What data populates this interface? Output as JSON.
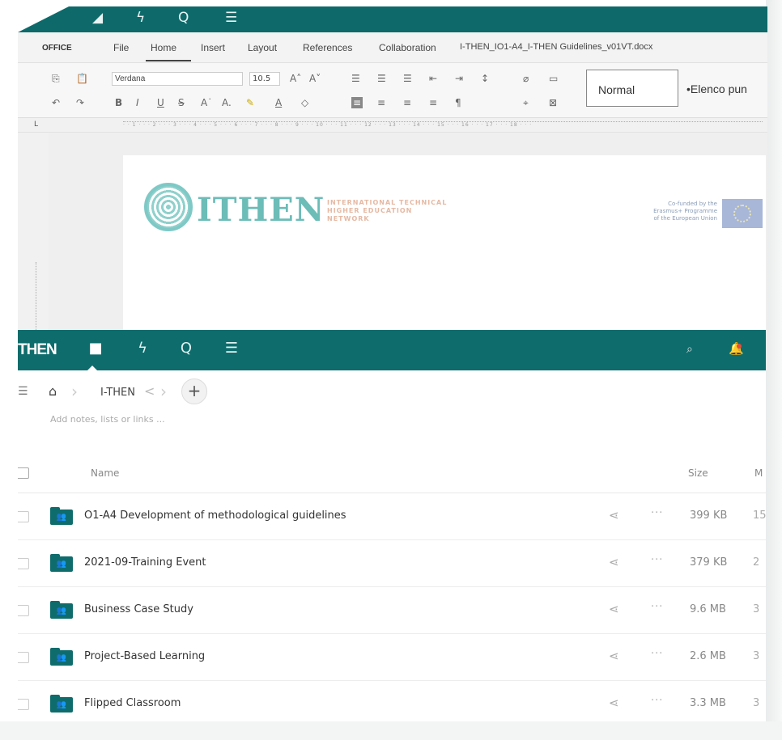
{
  "editor": {
    "brand": "OFFICE",
    "menu": [
      "File",
      "Home",
      "Insert",
      "Layout",
      "References",
      "Collaboration"
    ],
    "document_title": "I-THEN_IO1-A4_I-THEN Guidelines_v01VT.docx",
    "font_name": "Verdana",
    "font_size": "10.5",
    "styles": [
      "Normal",
      "•Elenco pun"
    ],
    "logo": {
      "name": "ITHEN",
      "subtitle_lines": [
        "INTERNATIONAL TECHNICAL",
        "HIGHER EDUCATION",
        "NETWORK"
      ],
      "cofund_lines": [
        "Co-funded by the",
        "Erasmus+ Programme",
        "of the European Union"
      ]
    },
    "colors": {
      "topbar": "#0e6a6a",
      "logo_teal": "#6cbcb8",
      "logo_peach": "#e6b9a3"
    }
  },
  "files_app": {
    "brand": "THEN",
    "nav_icons": [
      "folder-icon",
      "activity-icon",
      "search-icon",
      "list-icon"
    ],
    "breadcrumb": {
      "current": "I-THEN"
    },
    "notes_placeholder": "Add notes, lists or links ...",
    "columns": {
      "name": "Name",
      "size": "Size",
      "modified": "M"
    },
    "rows": [
      {
        "name": "O1-A4 Development of methodological guidelines",
        "size": "399 KB",
        "modified": "15"
      },
      {
        "name": "2021-09-Training Event",
        "size": "379 KB",
        "modified": "2"
      },
      {
        "name": "Business Case Study",
        "size": "9.6 MB",
        "modified": "3"
      },
      {
        "name": "Project-Based Learning",
        "size": "2.6 MB",
        "modified": "3"
      },
      {
        "name": "Flipped Classroom",
        "size": "3.3 MB",
        "modified": "3"
      }
    ],
    "colors": {
      "header": "#0f6c6c",
      "folder": "#0f6c6c",
      "notification": "#e44d3c"
    }
  }
}
